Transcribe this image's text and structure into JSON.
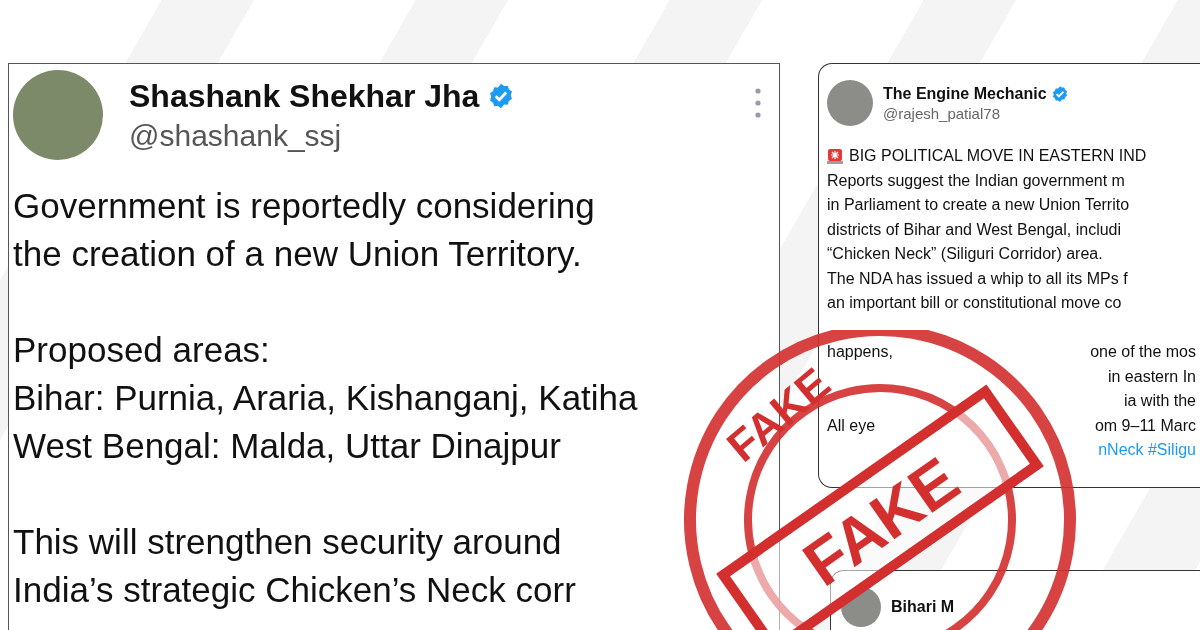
{
  "tweets": [
    {
      "name": "Shashank Shekhar Jha",
      "handle": "@shashank_ssj",
      "verified": true,
      "menu": true,
      "paragraphs": [
        "Government is reportedly considering\nthe creation of a new Union Territory.",
        "Proposed areas:\nBihar: Purnia, Araria, Kishanganj, Katiha\nWest Bengal: Malda, Uttar Dinajpur",
        "This will strengthen security around\nIndia’s strategic Chicken’s Neck corr"
      ]
    },
    {
      "name": "The Engine Mechanic",
      "handle": "@rajesh_patial78",
      "verified": true,
      "lines": [
        {
          "kind": "alert",
          "parts": [
            "BIG POLITICAL MOVE IN EASTERN IND"
          ]
        },
        {
          "kind": "text",
          "parts": [
            "Reports suggest the Indian government m"
          ]
        },
        {
          "kind": "text",
          "parts": [
            "in Parliament to create a new Union Territo"
          ]
        },
        {
          "kind": "text",
          "parts": [
            "districts of Bihar and West Bengal, includi"
          ]
        },
        {
          "kind": "text",
          "parts": [
            "“Chicken Neck” (Siliguri Corridor) area."
          ]
        },
        {
          "kind": "text",
          "parts": [
            "The NDA has issued a whip to all its MPs f"
          ]
        },
        {
          "kind": "text",
          "parts": [
            "an important bill or constitutional move co"
          ]
        },
        {
          "kind": "gap"
        },
        {
          "kind": "split",
          "parts": [
            "happens,",
            "one of the mos"
          ]
        },
        {
          "kind": "split",
          "parts": [
            "in eastern In"
          ]
        },
        {
          "kind": "split",
          "parts": [
            "ia with the"
          ]
        },
        {
          "kind": "split",
          "parts": [
            "All eye",
            "om 9–11 Marc"
          ]
        },
        {
          "kind": "link",
          "parts": [
            "nNeck #Siligu"
          ]
        }
      ]
    },
    {
      "name": "Bihari M"
    }
  ],
  "stamp": {
    "arc_label": "FAKE",
    "center_label": "FAKE"
  }
}
